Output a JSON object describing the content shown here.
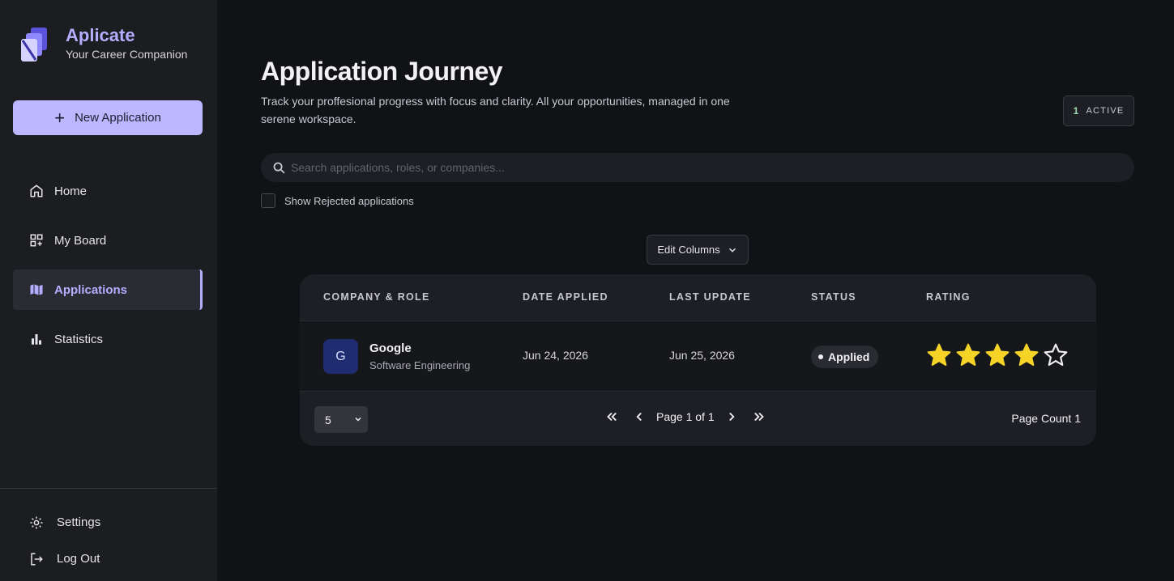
{
  "brand": {
    "title": "Aplicate",
    "subtitle": "Your Career Companion"
  },
  "sidebar": {
    "new_button": "New Application",
    "items": [
      {
        "label": "Home",
        "icon": "home-icon"
      },
      {
        "label": "My Board",
        "icon": "board-icon"
      },
      {
        "label": "Applications",
        "icon": "map-icon",
        "active": true
      },
      {
        "label": "Statistics",
        "icon": "bar-chart-icon"
      }
    ],
    "bottom": [
      {
        "label": "Settings",
        "icon": "gear-icon"
      },
      {
        "label": "Log Out",
        "icon": "logout-icon"
      }
    ]
  },
  "main": {
    "title": "Application Journey",
    "description": "Track your proffesional progress with focus and clarity. All your opportunities, managed in one serene workspace.",
    "active_count": "1",
    "active_label": "ACTIVE",
    "search_placeholder": "Search applications, roles, or companies...",
    "show_rejected_label": "Show Rejected applications",
    "edit_columns_label": "Edit Columns"
  },
  "table": {
    "headers": [
      "COMPANY & ROLE",
      "DATE APPLIED",
      "LAST UPDATE",
      "STATUS",
      "RATING"
    ],
    "rows": [
      {
        "initial": "G",
        "company": "Google",
        "role": "Software Engineering",
        "date_applied": "Jun 24, 2026",
        "last_update": "Jun 25, 2026",
        "status": "Applied",
        "rating": 4,
        "rating_max": 5
      }
    ],
    "footer": {
      "page_size": "5",
      "page_label": "Page 1 of 1",
      "page_count_label": "Page Count 1"
    }
  },
  "colors": {
    "accent": "#b3aeff",
    "star": "#f5d327",
    "avatar_bg": "#1f2c70"
  }
}
